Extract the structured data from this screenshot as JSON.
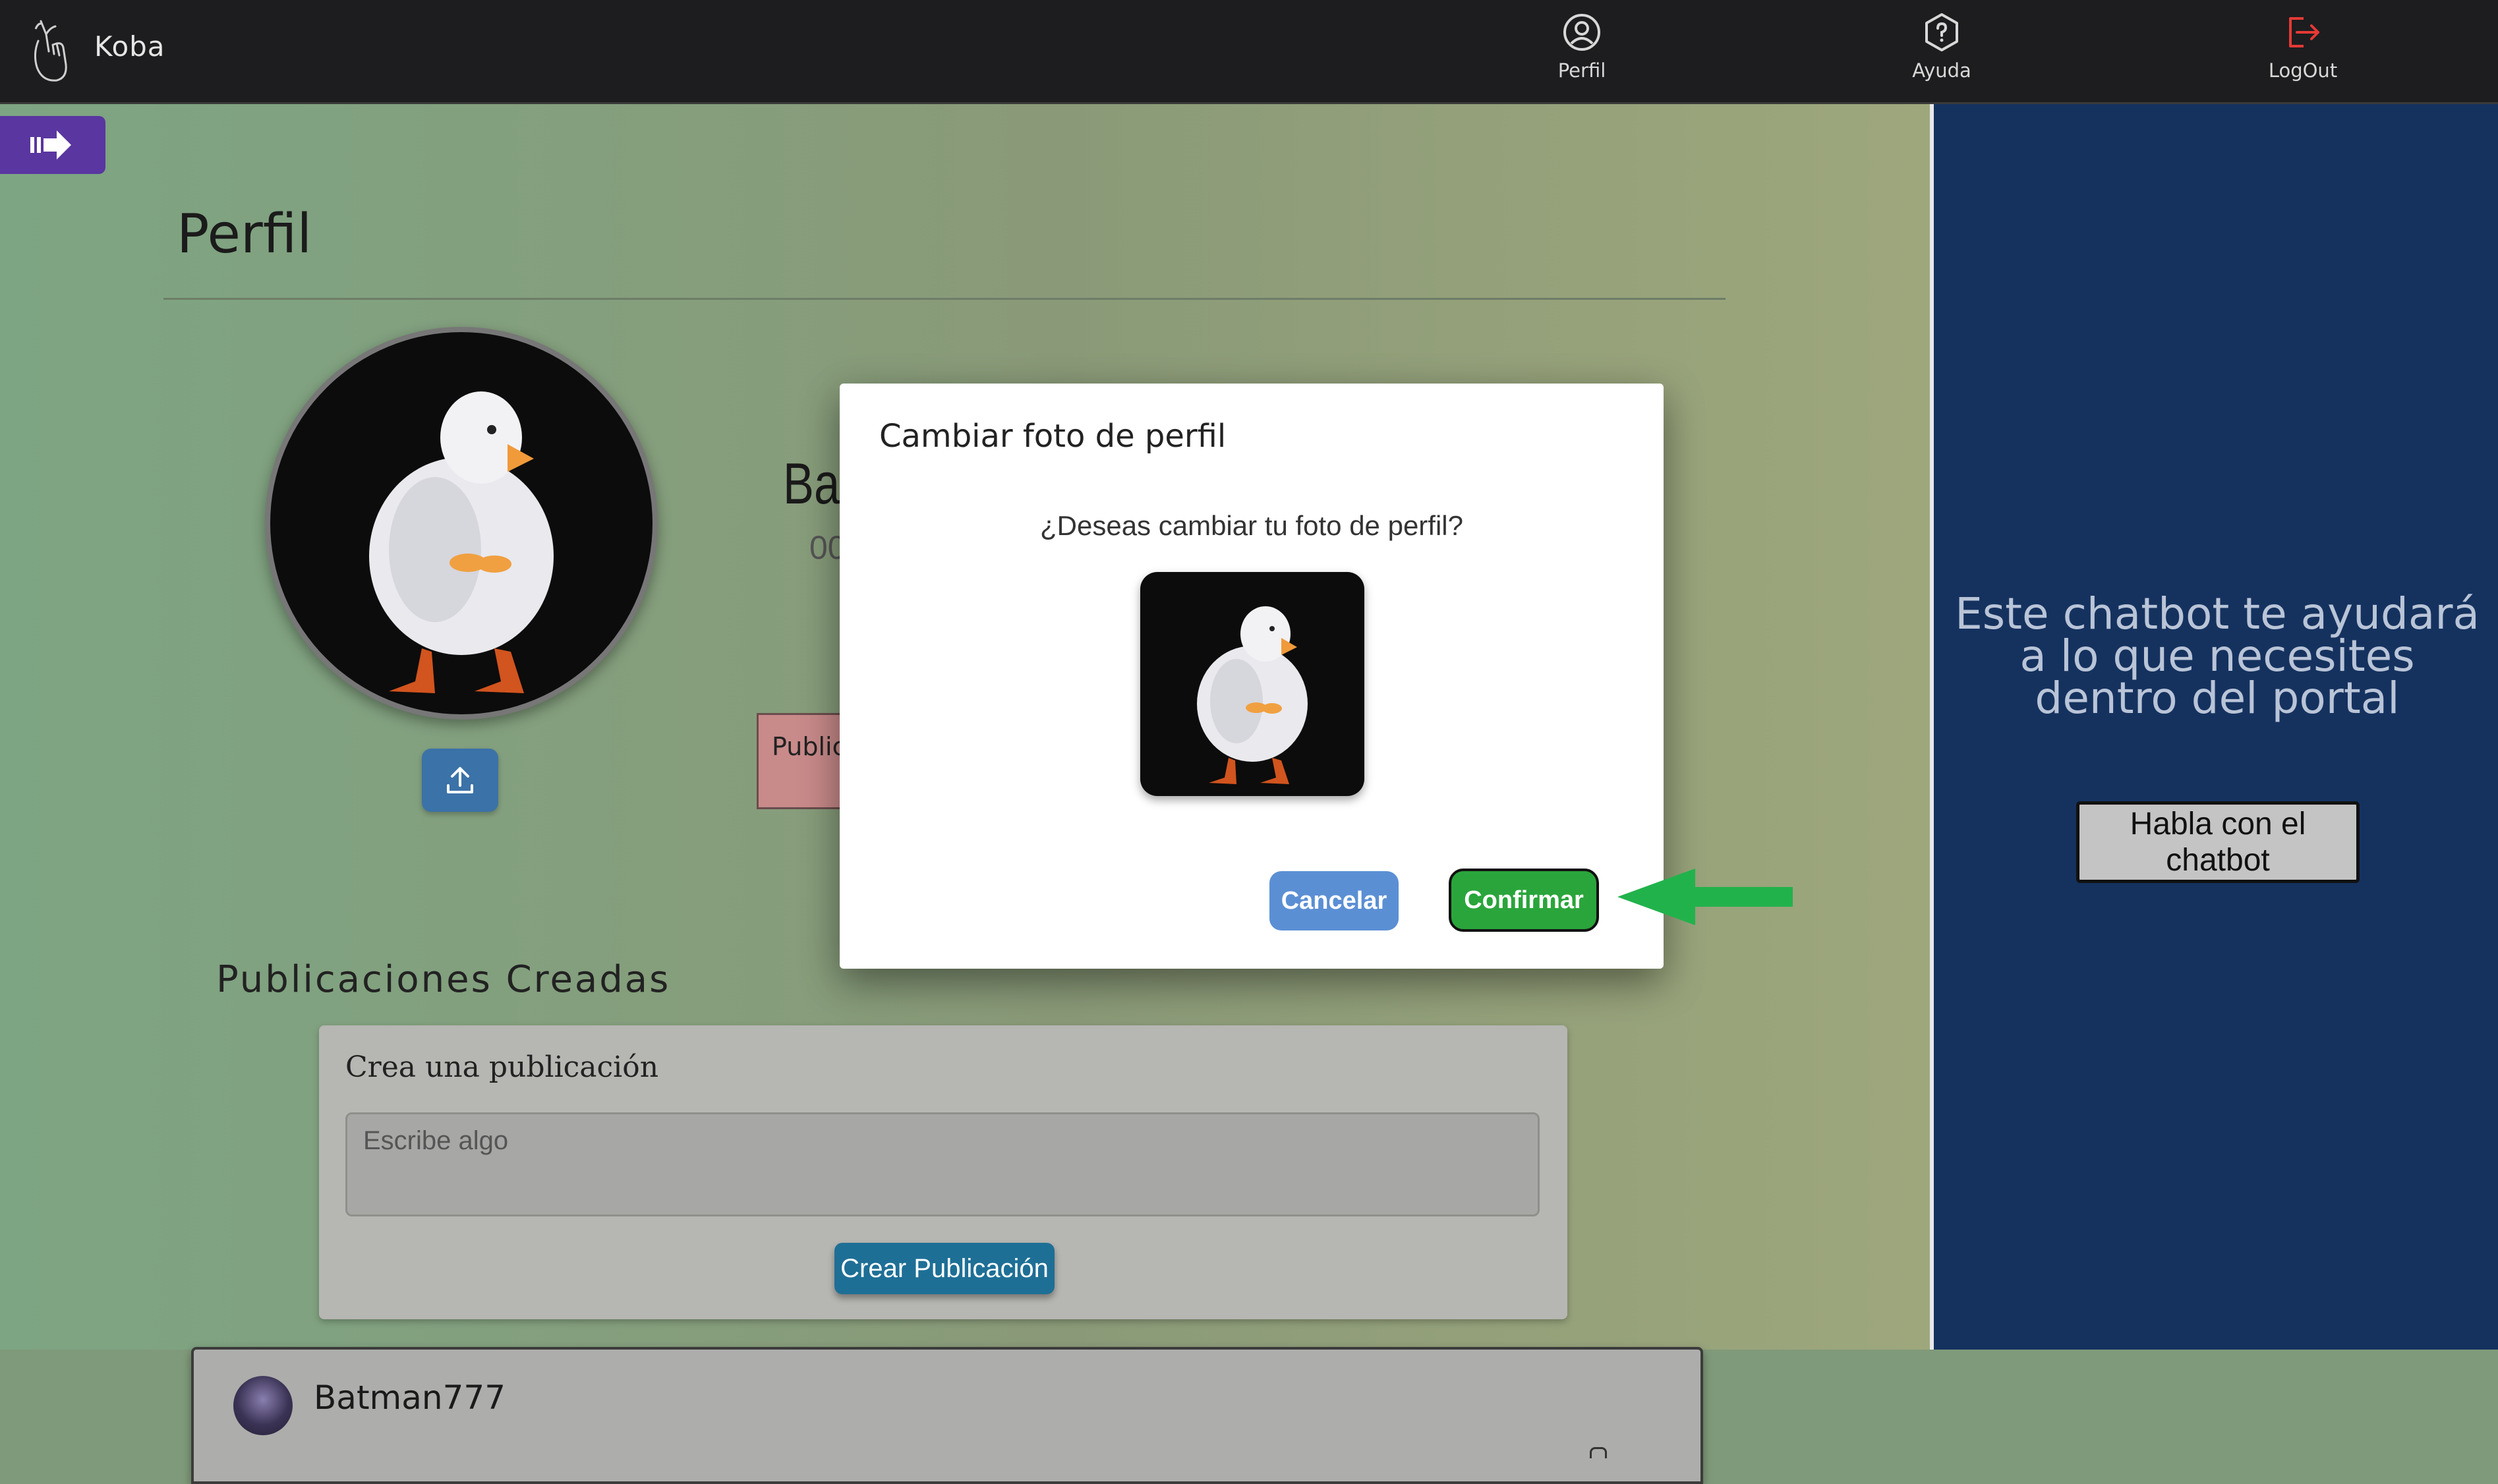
{
  "app": {
    "name": "Koba"
  },
  "nav": {
    "items": [
      {
        "label": "Perfil",
        "icon": "user-circle-icon"
      },
      {
        "label": "Ayuda",
        "icon": "help-hexagon-icon"
      },
      {
        "label": "LogOut",
        "icon": "logout-icon"
      }
    ]
  },
  "profile": {
    "title": "Perfil",
    "username_partial": "Bat",
    "stat_partial": "00",
    "publications_badge_partial": "Public",
    "section_title": "Publicaciones Creadas"
  },
  "create_post": {
    "title": "Crea una publicación",
    "placeholder": "Escribe algo",
    "button_label": "Crear Publicación"
  },
  "post": {
    "author": "Batman777"
  },
  "chatbot": {
    "message": "Este chatbot te ayudará a lo que necesites dentro del portal",
    "button_label": "Habla con el chatbot"
  },
  "modal": {
    "title": "Cambiar foto de perfil",
    "question": "¿Deseas cambiar tu foto de perfil?",
    "cancel_label": "Cancelar",
    "confirm_label": "Confirmar"
  },
  "colors": {
    "navbar": "#1d1d1f",
    "toggle": "#5a36a0",
    "chat_panel": "#15325f",
    "confirm": "#2aa53b",
    "cancel": "#5b8fd4",
    "logout": "#e53935",
    "arrow": "#22b24c"
  }
}
